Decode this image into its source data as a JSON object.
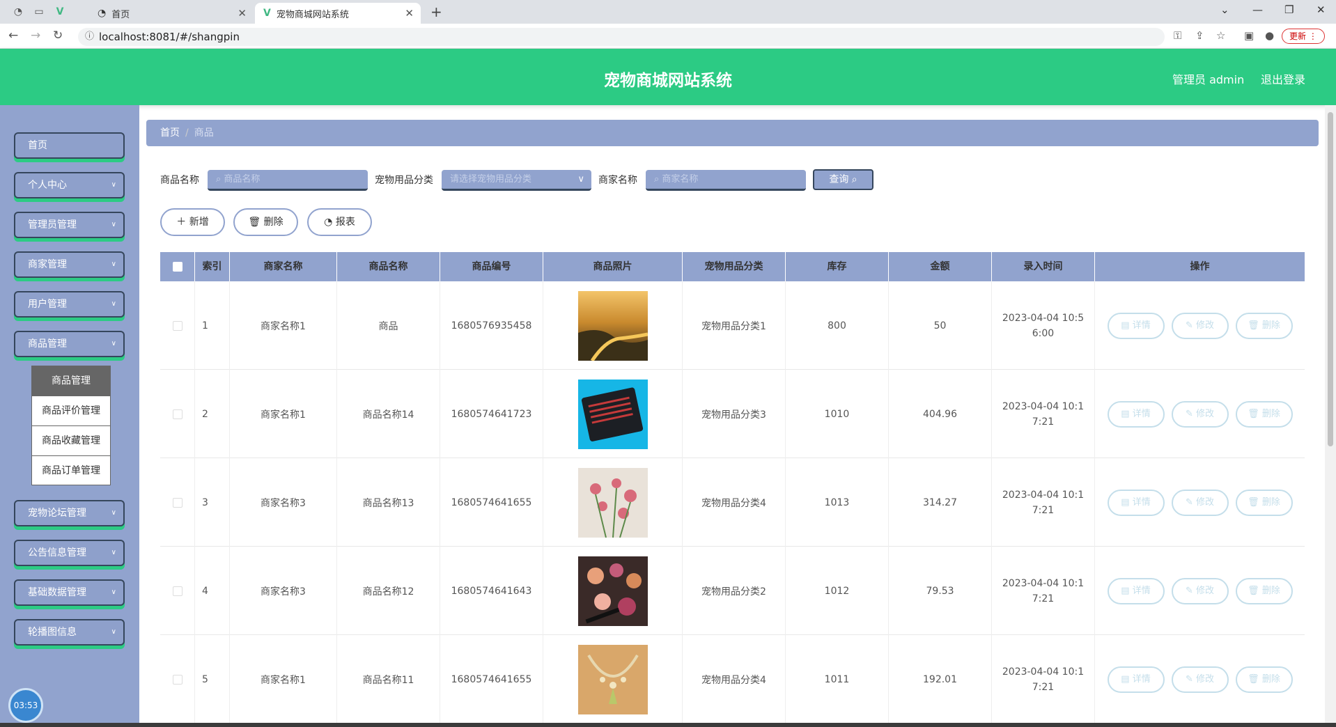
{
  "browser": {
    "tabs": [
      {
        "title": "首页"
      },
      {
        "title": "宠物商城网站系统"
      }
    ],
    "url": "localhost:8081/#/shangpin",
    "update_label": "更新"
  },
  "header": {
    "title": "宠物商城网站系统",
    "admin_label": "管理员 admin",
    "logout_label": "退出登录"
  },
  "sidebar": {
    "items": [
      {
        "label": "首页"
      },
      {
        "label": "个人中心"
      },
      {
        "label": "管理员管理"
      },
      {
        "label": "商家管理"
      },
      {
        "label": "用户管理"
      },
      {
        "label": "商品管理"
      },
      {
        "label": "宠物论坛管理"
      },
      {
        "label": "公告信息管理"
      },
      {
        "label": "基础数据管理"
      },
      {
        "label": "轮播图信息"
      }
    ],
    "submenu": [
      "商品管理",
      "商品评价管理",
      "商品收藏管理",
      "商品订单管理"
    ],
    "clock": "03:53"
  },
  "breadcrumb": {
    "home": "首页",
    "current": "商品"
  },
  "search": {
    "name_label": "商品名称",
    "name_placeholder": "商品名称",
    "category_label": "宠物用品分类",
    "category_placeholder": "请选择宠物用品分类",
    "shop_label": "商家名称",
    "shop_placeholder": "商家名称",
    "query_label": "查询"
  },
  "actions": {
    "add": "新增",
    "delete": "删除",
    "report": "报表"
  },
  "table": {
    "headers": [
      "索引",
      "商家名称",
      "商品名称",
      "商品编号",
      "商品照片",
      "宠物用品分类",
      "库存",
      "金额",
      "录入时间",
      "操作"
    ],
    "op_labels": {
      "detail": "详情",
      "edit": "修改",
      "delete": "删除"
    },
    "rows": [
      {
        "index": "1",
        "shop": "商家名称1",
        "name": "商品",
        "code": "1680576935458",
        "category": "宠物用品分类1",
        "stock": "800",
        "price": "50",
        "time": "2023-04-04 10:56:00",
        "photo": "river-landscape"
      },
      {
        "index": "2",
        "shop": "商家名称1",
        "name": "商品名称14",
        "code": "1680574641723",
        "category": "宠物用品分类3",
        "stock": "1010",
        "price": "404.96",
        "time": "2023-04-04 10:17:21",
        "photo": "laptop-keyboard"
      },
      {
        "index": "3",
        "shop": "商家名称3",
        "name": "商品名称13",
        "code": "1680574641655",
        "category": "宠物用品分类4",
        "stock": "1013",
        "price": "314.27",
        "time": "2023-04-04 10:17:21",
        "photo": "flowers"
      },
      {
        "index": "4",
        "shop": "商家名称3",
        "name": "商品名称12",
        "code": "1680574641643",
        "category": "宠物用品分类2",
        "stock": "1012",
        "price": "79.53",
        "time": "2023-04-04 10:17:21",
        "photo": "makeup"
      },
      {
        "index": "5",
        "shop": "商家名称1",
        "name": "商品名称11",
        "code": "1680574641655",
        "category": "宠物用品分类4",
        "stock": "1011",
        "price": "192.01",
        "time": "2023-04-04 10:17:21",
        "photo": "necklace"
      }
    ]
  },
  "colors": {
    "header_green": "#2ccb84",
    "sidebar_blue": "#91a3ce",
    "dark_border": "#35465c"
  }
}
